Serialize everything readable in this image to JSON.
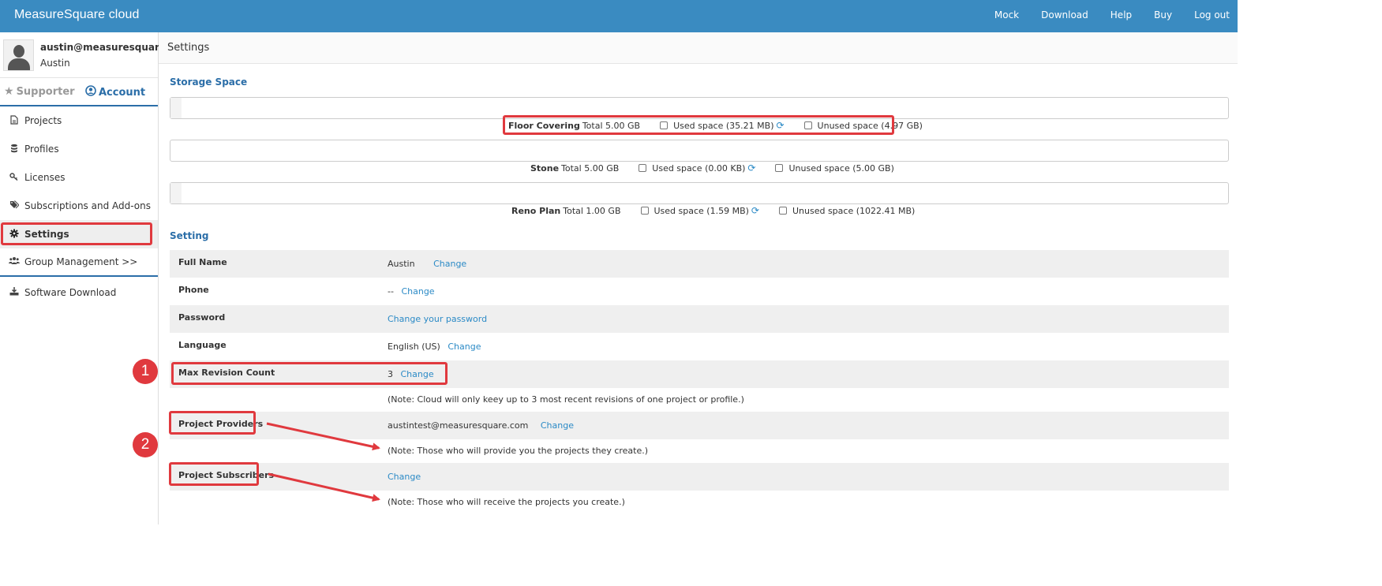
{
  "app": {
    "title": "MeasureSquare cloud"
  },
  "topnav": [
    "Mock",
    "Download",
    "Help",
    "Buy",
    "Log out"
  ],
  "user": {
    "email": "austin@measuresquare.c...",
    "name": "Austin"
  },
  "tabs": {
    "supporter": "Supporter",
    "account": "Account"
  },
  "menu": [
    {
      "label": "Projects",
      "icon": "file-icon"
    },
    {
      "label": "Profiles",
      "icon": "database-icon"
    },
    {
      "label": "Licenses",
      "icon": "key-icon"
    },
    {
      "label": "Subscriptions and Add-ons",
      "icon": "tags-icon"
    },
    {
      "label": "Settings",
      "icon": "gear-icon",
      "active": true
    },
    {
      "label": "Group Management >>",
      "icon": "users-icon"
    },
    {
      "label": "Software Download",
      "icon": "download-icon"
    }
  ],
  "breadcrumb": "Settings",
  "storage": {
    "title": "Storage Space",
    "items": [
      {
        "name": "Floor Covering",
        "total": "Total 5.00 GB",
        "used": "Used space (35.21 MB)",
        "unused": "Unused space (4.97 GB)",
        "used_fraction": 0.007
      },
      {
        "name": "Stone",
        "total": "Total 5.00 GB",
        "used": "Used space (0.00 KB)",
        "unused": "Unused space (5.00 GB)",
        "used_fraction": 0
      },
      {
        "name": "Reno Plan",
        "total": "Total 1.00 GB",
        "used": "Used space (1.59 MB)",
        "unused": "Unused space (1022.41 MB)",
        "used_fraction": 0.0016
      }
    ]
  },
  "setting": {
    "title": "Setting",
    "change": "Change",
    "rows": {
      "full_name": {
        "label": "Full Name",
        "value": "Austin"
      },
      "phone": {
        "label": "Phone",
        "value": "--"
      },
      "password": {
        "label": "Password",
        "link": "Change your password"
      },
      "language": {
        "label": "Language",
        "value": "English (US)"
      },
      "max_revision": {
        "label": "Max Revision Count",
        "value": "3",
        "note": "(Note: Cloud will only keey up to 3 most recent revisions of one project or profile.)"
      },
      "providers": {
        "label": "Project Providers",
        "value": "austintest@measuresquare.com",
        "note": "(Note: Those who will provide you the projects they create.)"
      },
      "subscribers": {
        "label": "Project Subscribers",
        "note": "(Note: Those who will receive the projects you create.)"
      }
    }
  },
  "annotations": {
    "badge1": "1",
    "badge2": "2"
  },
  "colors": {
    "topbar": "#3a8bc1",
    "link": "#2b8ac6",
    "accent": "#2b6ea8",
    "annotation": "#e0393e"
  }
}
